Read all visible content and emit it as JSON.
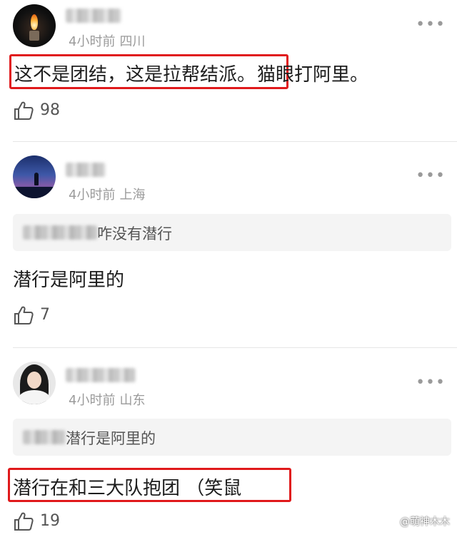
{
  "comments": [
    {
      "time": "4小时前",
      "location": "四川",
      "text_highlight": "这不是团结，这是拉帮结派。",
      "text_rest": "猫眼打阿里。",
      "likes": "98"
    },
    {
      "time": "4小时前",
      "location": "上海",
      "quote_text": "咋没有潜行",
      "text": "潜行是阿里的",
      "likes": "7"
    },
    {
      "time": "4小时前",
      "location": "山东",
      "quote_text": "潜行是阿里的",
      "text_highlight": "潜行在和三大队抱团 （笑鼠",
      "likes": "19"
    }
  ],
  "more_icon": "more-dots-icon",
  "like_icon": "thumbs-up-icon",
  "highlight_color": "#e0191b",
  "watermark": "@萌神木木"
}
